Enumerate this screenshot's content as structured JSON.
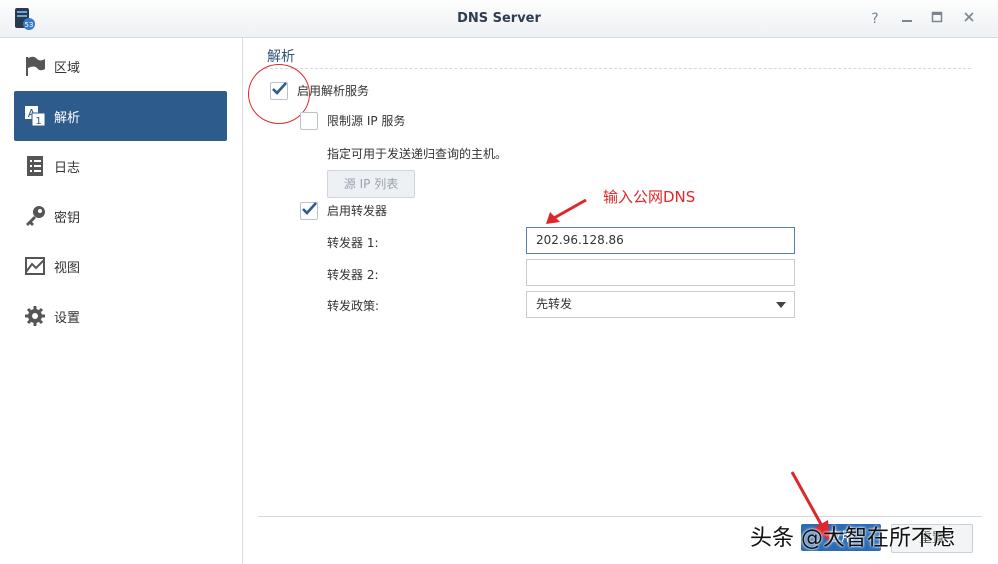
{
  "window": {
    "title": "DNS Server",
    "help_glyph": "?"
  },
  "sidebar": {
    "items": [
      {
        "label": "区域",
        "icon": "flag-icon"
      },
      {
        "label": "解析",
        "icon": "resolve-icon"
      },
      {
        "label": "日志",
        "icon": "log-icon"
      },
      {
        "label": "密钥",
        "icon": "key-icon"
      },
      {
        "label": "视图",
        "icon": "view-icon"
      },
      {
        "label": "设置",
        "icon": "gear-icon"
      }
    ],
    "active": "解析"
  },
  "main": {
    "section_title": "解析",
    "enable_resolve_label": "启用解析服务",
    "enable_resolve_checked": true,
    "limit_ip_label": "限制源 IP 服务",
    "limit_ip_checked": false,
    "limit_ip_desc": "指定可用于发送递归查询的主机。",
    "source_ip_list_button": "源 IP 列表",
    "enable_forwarder_label": "启用转发器",
    "enable_forwarder_checked": true,
    "forwarder1_label": "转发器 1:",
    "forwarder1_value": "202.96.128.86",
    "forwarder2_label": "转发器 2:",
    "forwarder2_value": "",
    "policy_label": "转发政策:",
    "policy_value": "先转发"
  },
  "annotation": {
    "text": "输入公网DNS",
    "color": "#e0262b"
  },
  "footer": {
    "apply_label": "应用",
    "reset_label": "重置"
  },
  "watermark": "头条 @大智在所不虑",
  "colors": {
    "accent": "#2d5c8c",
    "primary_button": "#2c6cb5",
    "annotation": "#e0262b"
  }
}
